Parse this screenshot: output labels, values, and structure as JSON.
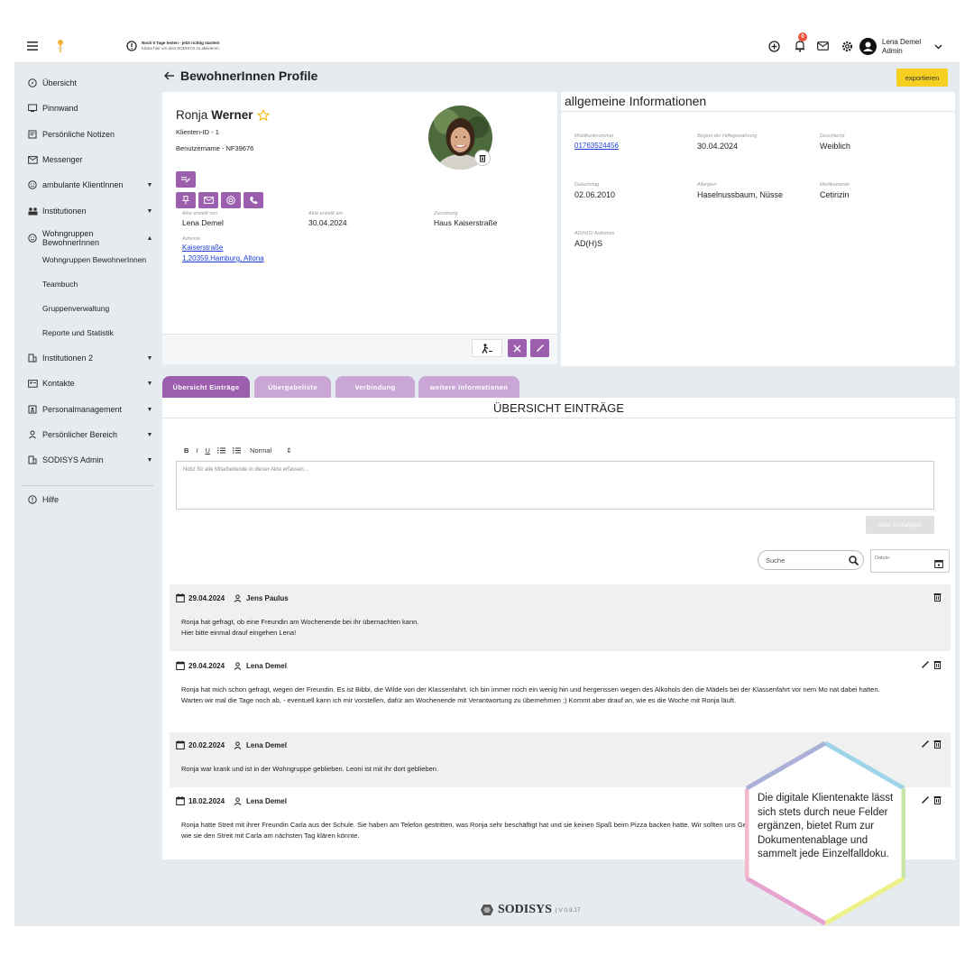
{
  "topbar": {
    "trial_title": "Noch 0 Tage testen - jetzt richtig starten!",
    "trial_sub": "Klicke hier um dein SODISYS zu aktivieren.",
    "notif_count": "0",
    "user_name": "Lena Demel",
    "user_role": "Admin"
  },
  "sidebar": {
    "items": [
      {
        "label": "Übersicht"
      },
      {
        "label": "Pinnwand"
      },
      {
        "label": "Persönliche Notizen"
      },
      {
        "label": "Messenger"
      },
      {
        "label": "ambulante KlientInnen"
      },
      {
        "label": "Institutionen"
      },
      {
        "label": "Wohngruppen BewohnerInnen"
      },
      {
        "label": "Institutionen 2"
      },
      {
        "label": "Kontakte"
      },
      {
        "label": "Personalmanagement"
      },
      {
        "label": "Persönlicher Bereich"
      },
      {
        "label": "SODISYS Admin"
      },
      {
        "label": "Hilfe"
      }
    ],
    "subitems": [
      {
        "label": "Wohngruppen BewohnerInnen"
      },
      {
        "label": "Teambuch"
      },
      {
        "label": "Gruppenverwaltung"
      },
      {
        "label": "Reporte und Statistik"
      }
    ]
  },
  "page": {
    "title": "BewohnerInnen Profile",
    "export_label": "exportieren"
  },
  "profile": {
    "first_name": "Ronja",
    "last_name": "Werner",
    "client_id": "Klienten-ID - 1",
    "username": "Benutzername - NF39676",
    "created_by_label": "Akte erstellt von",
    "created_by": "Lena Demel",
    "created_at_label": "Akte erstellt am",
    "created_at": "30.04.2024",
    "assignment_label": "Zuordnung",
    "assignment": "Haus Kaiserstraße",
    "address_label": "Adresse",
    "address_line1": "Kaiserstraße",
    "address_line2": "1,20359,Hamburg, Altona"
  },
  "info": {
    "title": "allgemeine Informationen",
    "mobile_label": "Mobilfunknummer",
    "mobile": "01763524456",
    "start_label": "Beginn der Hilfegewährung",
    "start": "30.04.2024",
    "gender_label": "Geschlecht",
    "gender": "Weiblich",
    "birthday_label": "Geburtstag",
    "birthday": "02.06.2010",
    "allergies_label": "Allergien",
    "allergies": "Haselnussbaum, Nüsse",
    "meds_label": "Medikamente",
    "meds": "Cetirizin",
    "adhs_label": "AD(H)S/ Autismus",
    "adhs": "AD(H)S"
  },
  "tabs": [
    {
      "label": "Übersicht Einträge"
    },
    {
      "label": "Übergabeliste"
    },
    {
      "label": "Verbindung"
    },
    {
      "label": "weitere Informationen"
    }
  ],
  "entries_section": {
    "title": "ÜBERSICHT EINTRÄGE",
    "format_label": "Normal",
    "note_placeholder": "Notiz für alle Mitarbeitende in dieser Akte erfassen...",
    "add_note_label": "Notiz hinzufügen",
    "search_placeholder": "Suche",
    "date_placeholder": "Datum"
  },
  "entries": [
    {
      "date": "29.04.2024",
      "author": "Jens Paulus",
      "lines": [
        "Ronja hat gefragt, ob eine Freundin am Wochenende bei ihr übernachten kann.",
        "Hier bitte einmal drauf eingehen Lena!"
      ]
    },
    {
      "date": "29.04.2024",
      "author": "Lena Demel",
      "lines": [
        "Ronja hat mich schon gefragt, wegen der Freundin. Es ist Bibbi, die Wilde von der Klassenfahrt. Ich bin immer noch ein wenig hin und hergerissen wegen des Alkohols den die Mädels bei der Klassenfahrt vor nem Mo nat dabei hatten.",
        "Warten wir mal die Tage noch ab, - eventuell kann ich mir vorstellen, dafür am Wochenende mit Verantwortung zu übernehmen ;) Kommt aber drauf an, wie es die Woche mit Ronja läuft."
      ]
    },
    {
      "date": "20.02.2024",
      "author": "Lena Demel",
      "lines": [
        "Ronja war krank und ist in der Wohngruppe geblieben. Leoni ist mit ihr dort geblieben."
      ]
    },
    {
      "date": "18.02.2024",
      "author": "Lena Demel",
      "lines": [
        "Ronja hatte Streit mit ihrer Freundin Carla aus der Schule. Sie haben am Telefon gestritten, was Ronja sehr beschäftigt hat und sie keinen Spaß beim Pizza backen hatte. Wir sollten uns Gedanken machen,",
        "wie sie den Streit mit Carla am nächsten Tag klären könnte."
      ]
    }
  ],
  "footer": {
    "brand": "SODISYS",
    "version": "| V 0.9.17"
  },
  "overlay": {
    "text": "Die digitale Klientenakte lässt sich stets durch neue Felder ergänzen, bietet Rum zur Dokumentenablage und sammelt jede Einzelfalldoku."
  },
  "colors": {
    "accent": "#9b5fae",
    "accent_light": "#c9a6d6",
    "export": "#f5d020",
    "link": "#1a3fd6"
  }
}
